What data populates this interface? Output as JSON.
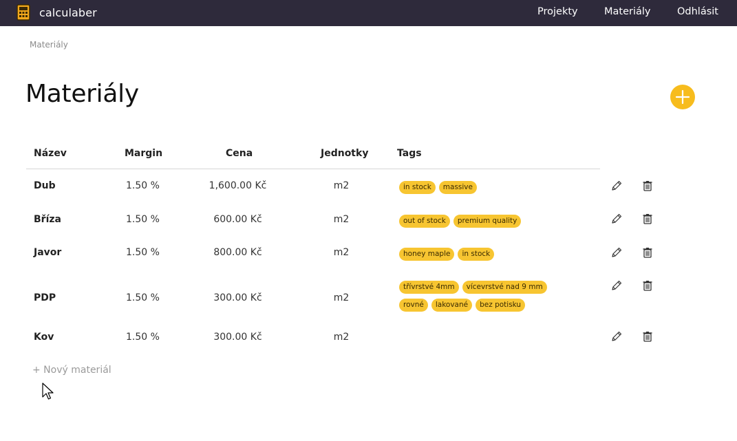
{
  "app": {
    "name": "calculaber",
    "icon": "calculator-icon"
  },
  "nav": {
    "projekty": "Projekty",
    "materialy": "Materiály",
    "odhlasit": "Odhlásit"
  },
  "breadcrumb": "Materiály",
  "title": "Materiály",
  "add_button": {
    "icon": "plus-icon"
  },
  "table": {
    "headers": {
      "name": "Název",
      "margin": "Margin",
      "price": "Cena",
      "units": "Jednotky",
      "tags": "Tags"
    },
    "rows": [
      {
        "name": "Dub",
        "margin": "1.50 %",
        "price": "1,600.00 Kč",
        "unit": "m2",
        "tags": [
          "in stock",
          "massive"
        ]
      },
      {
        "name": "Bříza",
        "margin": "1.50 %",
        "price": "600.00 Kč",
        "unit": "m2",
        "tags": [
          "out of stock",
          "premium quality"
        ]
      },
      {
        "name": "Javor",
        "margin": "1.50 %",
        "price": "800.00 Kč",
        "unit": "m2",
        "tags": [
          "honey maple",
          "in stock"
        ]
      },
      {
        "name": "PDP",
        "margin": "1.50 %",
        "price": "300.00 Kč",
        "unit": "m2",
        "tags": [
          "třívrstvé 4mm",
          "vícevrstvé nad 9 mm",
          "rovné",
          "lakované",
          "bez potisku"
        ]
      },
      {
        "name": "Kov",
        "margin": "1.50 %",
        "price": "300.00 Kč",
        "unit": "m2",
        "tags": []
      }
    ],
    "action_icons": {
      "edit": "pencil-icon",
      "delete": "trash-icon"
    }
  },
  "new_material_link": "+ Nový materiál",
  "colors": {
    "navbar": "#2e2a3b",
    "accent": "#f7bc1d",
    "tag": "#f7c531"
  }
}
